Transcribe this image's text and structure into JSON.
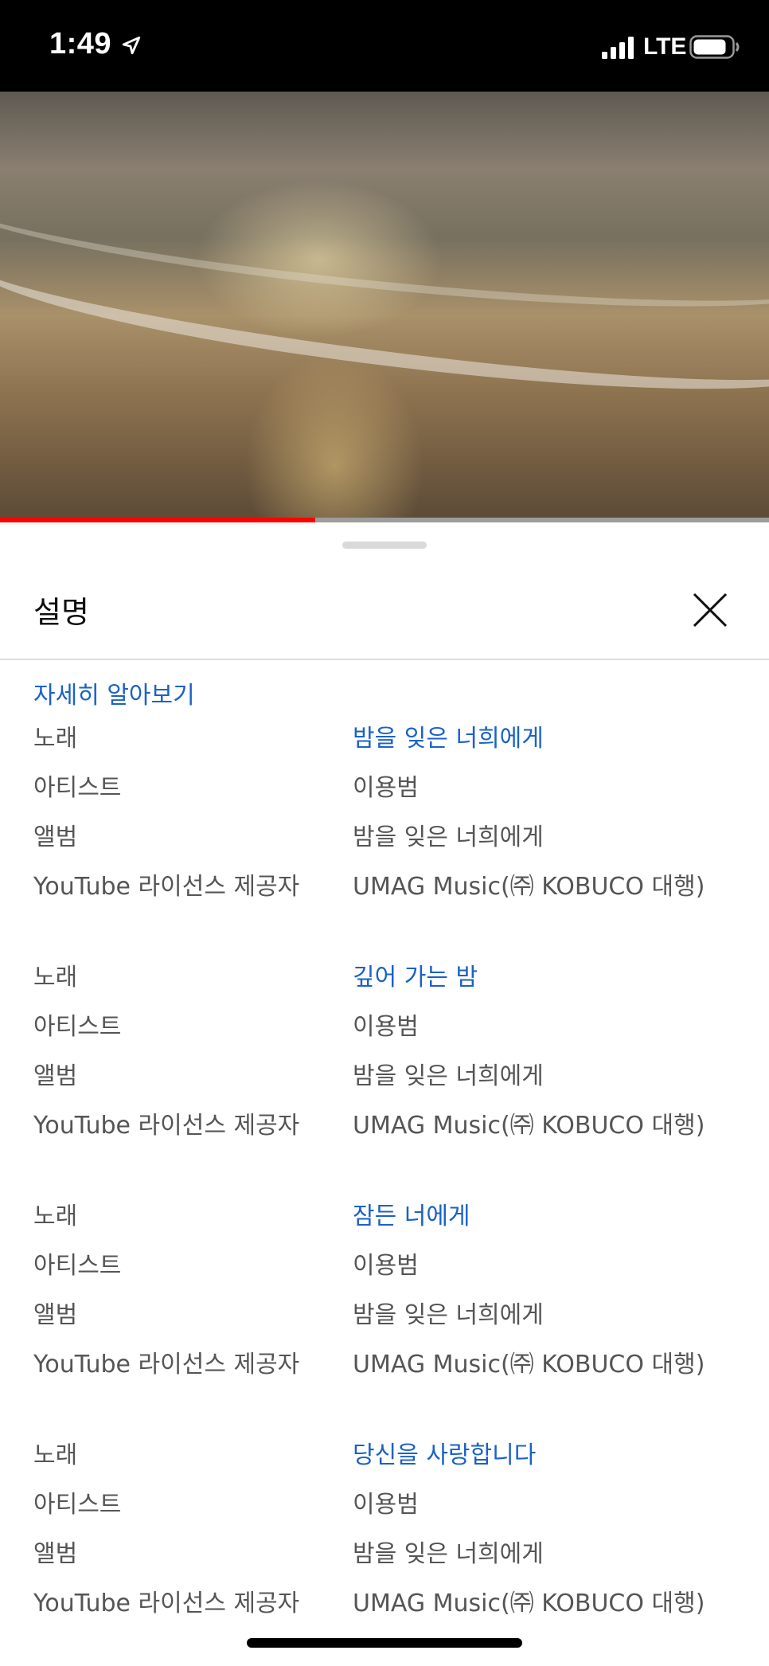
{
  "status_bar": {
    "time": "1:49",
    "network": "LTE",
    "icons": [
      "location-arrow-icon",
      "signal-bars-icon",
      "battery-icon"
    ]
  },
  "video": {
    "progress": 0.41,
    "progress_color": "#ff0000"
  },
  "sheet": {
    "title": "설명",
    "learn_more": "자세히 알아보기",
    "link_color": "#1a62c7",
    "songs": [
      {
        "labels": {
          "song": "노래",
          "artist": "아티스트",
          "album": "앨범",
          "license": "YouTube 라이선스 제공자"
        },
        "song": "밤을 잊은 너희에게",
        "artist": "이용범",
        "album": "밤을 잊은 너희에게",
        "license": "UMAG Music(㈜ KOBUCO 대행)"
      },
      {
        "labels": {
          "song": "노래",
          "artist": "아티스트",
          "album": "앨범",
          "license": "YouTube 라이선스 제공자"
        },
        "song": "깊어 가는 밤",
        "artist": "이용범",
        "album": "밤을 잊은 너희에게",
        "license": "UMAG Music(㈜ KOBUCO 대행)"
      },
      {
        "labels": {
          "song": "노래",
          "artist": "아티스트",
          "album": "앨범",
          "license": "YouTube 라이선스 제공자"
        },
        "song": "잠든 너에게",
        "artist": "이용범",
        "album": "밤을 잊은 너희에게",
        "license": "UMAG Music(㈜ KOBUCO 대행)"
      },
      {
        "labels": {
          "song": "노래",
          "artist": "아티스트",
          "album": "앨범",
          "license": "YouTube 라이선스 제공자"
        },
        "song": "당신을 사랑합니다",
        "artist": "이용범",
        "album": "밤을 잊은 너희에게",
        "license": "UMAG Music(㈜ KOBUCO 대행)"
      }
    ]
  }
}
